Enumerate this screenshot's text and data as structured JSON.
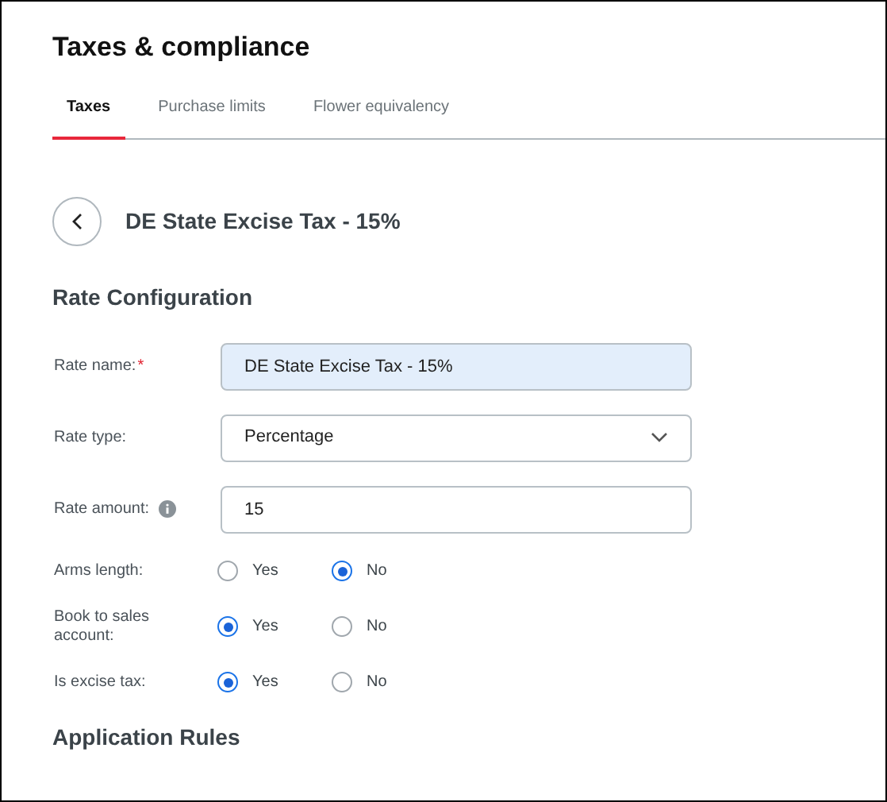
{
  "page_title": "Taxes & compliance",
  "tabs": [
    {
      "label": "Taxes",
      "selected": true
    },
    {
      "label": "Purchase limits",
      "selected": false
    },
    {
      "label": "Flower equivalency",
      "selected": false
    }
  ],
  "detail_title": "DE State Excise Tax - 15%",
  "section_title": "Rate Configuration",
  "fields": [
    {
      "kind": "text",
      "label": "Rate name:",
      "required_mark": "*",
      "info": false,
      "value": "DE State Excise Tax - 15%",
      "focused": true
    },
    {
      "kind": "select",
      "label": "Rate type:",
      "info": false,
      "value": "Percentage",
      "focused": false
    },
    {
      "kind": "text",
      "label": "Rate amount:",
      "info": true,
      "value": "15",
      "focused": false
    }
  ],
  "radio_groups": [
    {
      "label": "Arms length:",
      "options": [
        {
          "label": "Yes",
          "selected": false
        },
        {
          "label": "No",
          "selected": true
        }
      ]
    },
    {
      "label": "Book to sales account:",
      "options": [
        {
          "label": "Yes",
          "selected": true
        },
        {
          "label": "No",
          "selected": false
        }
      ]
    },
    {
      "label": "Is excise tax:",
      "options": [
        {
          "label": "Yes",
          "selected": true
        },
        {
          "label": "No",
          "selected": false
        }
      ]
    }
  ],
  "next_section_title": "Application Rules"
}
